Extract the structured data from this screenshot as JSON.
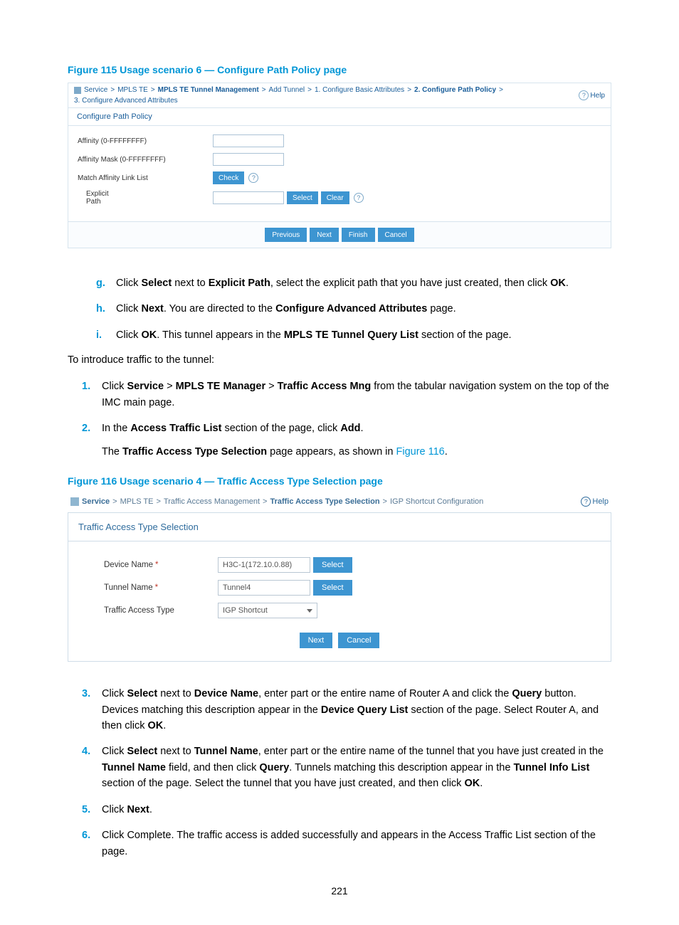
{
  "fig115": {
    "caption": "Figure 115 Usage scenario 6 — Configure Path Policy page",
    "breadcrumb": {
      "items": [
        {
          "label": "Service",
          "bold": false
        },
        {
          "label": "MPLS TE",
          "bold": false
        },
        {
          "label": "MPLS TE Tunnel Management",
          "bold": true
        },
        {
          "label": "Add Tunnel",
          "bold": false
        },
        {
          "label": "1. Configure Basic Attributes",
          "bold": false
        },
        {
          "label": "2. Configure Path Policy",
          "bold": true
        },
        {
          "label": "3. Configure Advanced Attributes",
          "bold": false
        }
      ],
      "help": "Help"
    },
    "panel_title": "Configure Path Policy",
    "rows": {
      "affinity": "Affinity (0-FFFFFFFF)",
      "mask": "Affinity Mask (0-FFFFFFFF)",
      "match_link": "Match Affinity Link List",
      "check_btn": "Check",
      "explicit_path": "Explicit\nPath",
      "select_btn": "Select",
      "clear_btn": "Clear"
    },
    "bottom": {
      "previous": "Previous",
      "next": "Next",
      "finish": "Finish",
      "cancel": "Cancel"
    }
  },
  "steps_gh": {
    "g": {
      "bullet": "g.",
      "pre": "Click ",
      "b1": "Select",
      "mid1": " next to ",
      "b2": "Explicit Path",
      "mid2": ", select the explicit path that you have just created, then click ",
      "b3": "OK",
      "post": "."
    },
    "h": {
      "bullet": "h.",
      "pre": "Click ",
      "b1": "Next",
      "mid1": ". You are directed to the ",
      "b2": "Configure Advanced Attributes",
      "post": " page."
    },
    "i": {
      "bullet": "i.",
      "pre": "Click ",
      "b1": "OK",
      "mid1": ". This tunnel appears in the ",
      "b2": "MPLS TE Tunnel Query List",
      "post": " section of the page."
    }
  },
  "intro_line": "To introduce traffic to the tunnel:",
  "steps_num_a": {
    "s1": {
      "bullet": "1.",
      "pre": "Click ",
      "b1": "Service",
      "s1": " > ",
      "b2": "MPLS TE Manager",
      "s2": " > ",
      "b3": "Traffic Access Mng",
      "post": " from the tabular navigation system on the top of the IMC main page."
    },
    "s2": {
      "bullet": "2.",
      "pre": "In the ",
      "b1": "Access Traffic List",
      "mid": " section of the page, click ",
      "b2": "Add",
      "post": ".",
      "sub_pre": "The ",
      "sub_b": "Traffic Access Type Selection",
      "sub_mid": " page appears, as shown in ",
      "sub_link": "Figure 116",
      "sub_post": "."
    }
  },
  "fig116": {
    "caption": "Figure 116 Usage scenario 4 — Traffic Access Type Selection page",
    "breadcrumb": {
      "service": "Service",
      "mpls": "MPLS TE",
      "tam": "Traffic Access Management",
      "tats": "Traffic Access Type Selection",
      "igp": "IGP Shortcut Configuration",
      "help": "Help"
    },
    "panel_title": "Traffic Access Type Selection",
    "rows": {
      "device_label": "Device Name",
      "device_value": "H3C-1(172.10.0.88)",
      "tunnel_label": "Tunnel Name",
      "tunnel_value": "Tunnel4",
      "type_label": "Traffic Access Type",
      "type_value": "IGP Shortcut",
      "select": "Select"
    },
    "buttons": {
      "next": "Next",
      "cancel": "Cancel"
    }
  },
  "steps_num_b": {
    "s3": {
      "bullet": "3.",
      "pre": "Click ",
      "b1": "Select",
      "m1": " next to ",
      "b2": "Device Name",
      "m2": ", enter part or the entire name of Router A and click the ",
      "b3": "Query",
      "m3": " button. Devices matching this description appear in the ",
      "b4": "Device Query List",
      "m4": " section of the page. Select Router A, and then click ",
      "b5": "OK",
      "post": "."
    },
    "s4": {
      "bullet": "4.",
      "pre": "Click ",
      "b1": "Select",
      "m1": " next to ",
      "b2": "Tunnel Name",
      "m2": ", enter part or the entire name of the tunnel that you have just created in the ",
      "b3": "Tunnel Name",
      "m3": " field, and then click ",
      "b4": "Query",
      "m4": ". Tunnels matching this description appear in the ",
      "b5": "Tunnel Info List",
      "m5": " section of the page. Select the tunnel that you have just created, and then click ",
      "b6": "OK",
      "post": "."
    },
    "s5": {
      "bullet": "5.",
      "pre": "Click ",
      "b1": "Next",
      "post": "."
    },
    "s6": {
      "bullet": "6.",
      "text": "Click Complete. The traffic access is added successfully and appears in the Access Traffic List section of the page."
    }
  },
  "page_number": "221"
}
